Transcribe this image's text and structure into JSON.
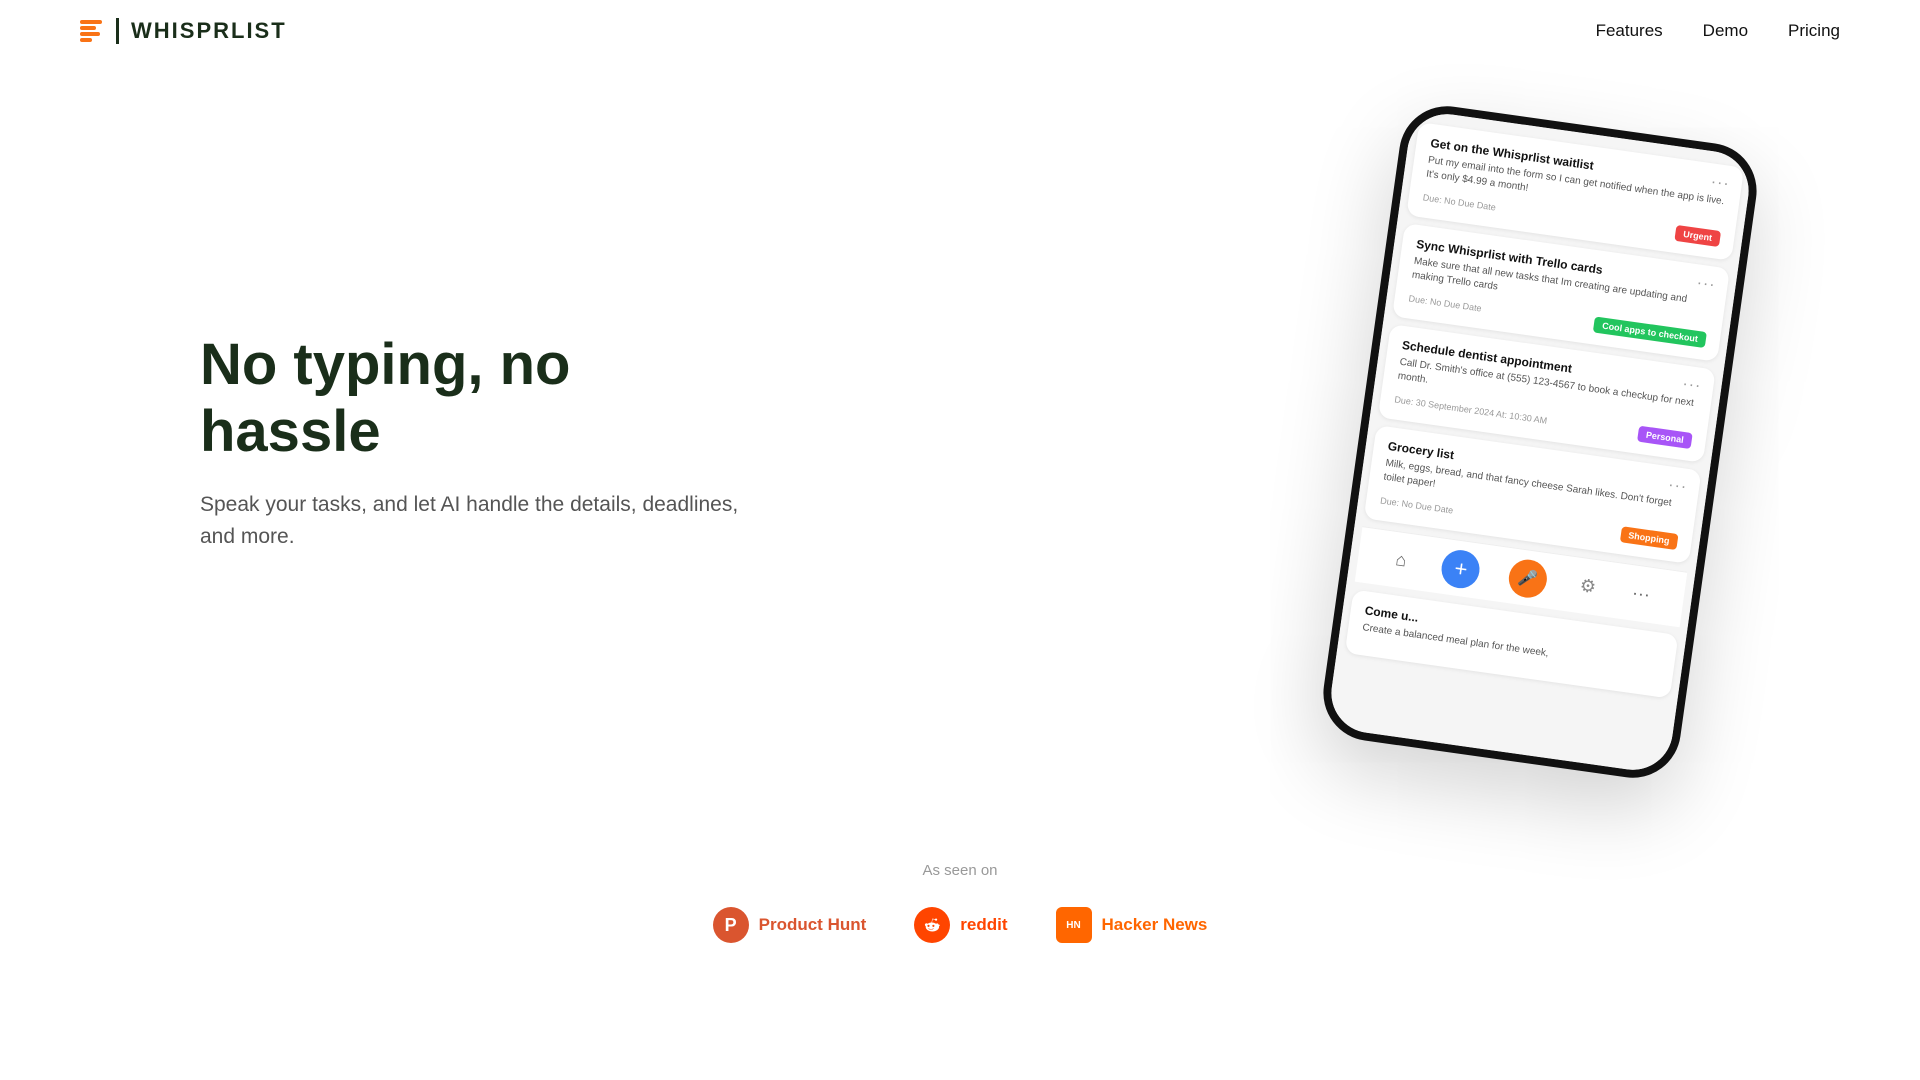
{
  "nav": {
    "logo_text": "WHISPRLIST",
    "links": [
      {
        "label": "Features",
        "href": "#"
      },
      {
        "label": "Demo",
        "href": "#"
      },
      {
        "label": "Pricing",
        "href": "#"
      }
    ]
  },
  "hero": {
    "title": "No typing, no hassle",
    "subtitle": "Speak your tasks, and let AI handle the details, deadlines, and more."
  },
  "phone": {
    "tasks": [
      {
        "title": "Get on the Whisprlist waitlist",
        "desc": "Put my email into the form so I can get notified when the app is live. It's only $4.99 a month!",
        "due": "Due: No Due Date",
        "tag": "Urgent",
        "tag_class": "tag-urgent"
      },
      {
        "title": "Sync Whisprlist with Trello cards",
        "desc": "Make sure that all new tasks that Im creating are updating and making Trello cards",
        "due": "Due: No Due Date",
        "tag": "Cool apps to checkout",
        "tag_class": "tag-cool"
      },
      {
        "title": "Schedule dentist appointment",
        "desc": "Call Dr. Smith's office at (555) 123-4567 to book a checkup for next month.",
        "due": "Due: 30 September 2024 At: 10:30 AM",
        "tag": "Personal",
        "tag_class": "tag-personal"
      },
      {
        "title": "Grocery list",
        "desc": "Milk, eggs, bread, and that fancy cheese Sarah likes. Don't forget toilet paper!",
        "due": "Due: No Due Date",
        "tag": "Shopping",
        "tag_class": "tag-shopping"
      },
      {
        "title": "Come u...",
        "desc": "Create a balanced meal plan for the week,",
        "due": "",
        "tag": "",
        "tag_class": ""
      }
    ]
  },
  "as_seen": {
    "label": "As seen on",
    "brands": [
      {
        "name": "Product Hunt",
        "type": "ph"
      },
      {
        "name": "reddit",
        "type": "reddit"
      },
      {
        "name": "Hacker News",
        "type": "hn"
      }
    ]
  }
}
